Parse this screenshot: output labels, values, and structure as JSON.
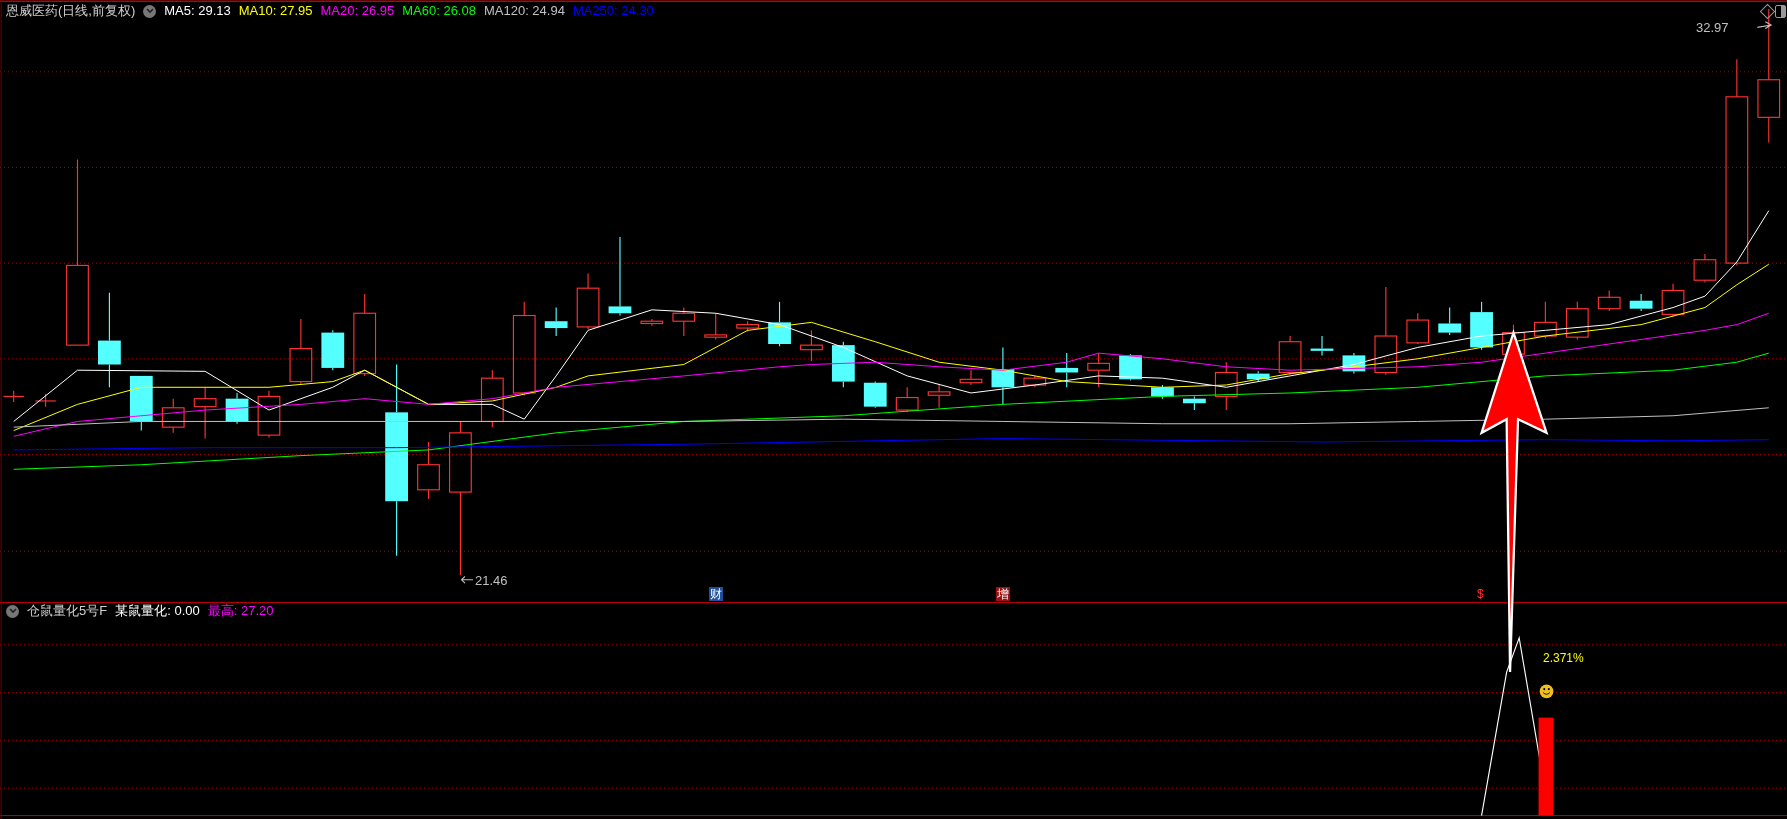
{
  "chart_header": {
    "title": "恩威医药(日线,前复权)",
    "moving_averages": [
      {
        "label": "MA5:",
        "value": "29.13",
        "color": "#ffffff"
      },
      {
        "label": "MA10:",
        "value": "27.95",
        "color": "#ffff00"
      },
      {
        "label": "MA20:",
        "value": "26.95",
        "color": "#ff00ff"
      },
      {
        "label": "MA60:",
        "value": "26.08",
        "color": "#00ff00"
      },
      {
        "label": "MA120:",
        "value": "24.94",
        "color": "#c0c0c0"
      },
      {
        "label": "MA250:",
        "value": "24.30",
        "color": "#0000ff"
      }
    ]
  },
  "price_labels": {
    "high": "32.97",
    "low": "21.46"
  },
  "event_markers": [
    {
      "label": "财",
      "color": "#1e4f9a"
    },
    {
      "label": "增",
      "color": "#9a1010"
    },
    {
      "label": "$",
      "color": "#000000"
    }
  ],
  "indicator_panel": {
    "title": "仓鼠量化5号F",
    "values": [
      {
        "label": "某鼠量化:",
        "value": "0.00",
        "color": "#ffffff"
      },
      {
        "label": "最高:",
        "value": "27.20",
        "color": "#ff00ff"
      }
    ],
    "signal_text": "2.371%"
  }
}
